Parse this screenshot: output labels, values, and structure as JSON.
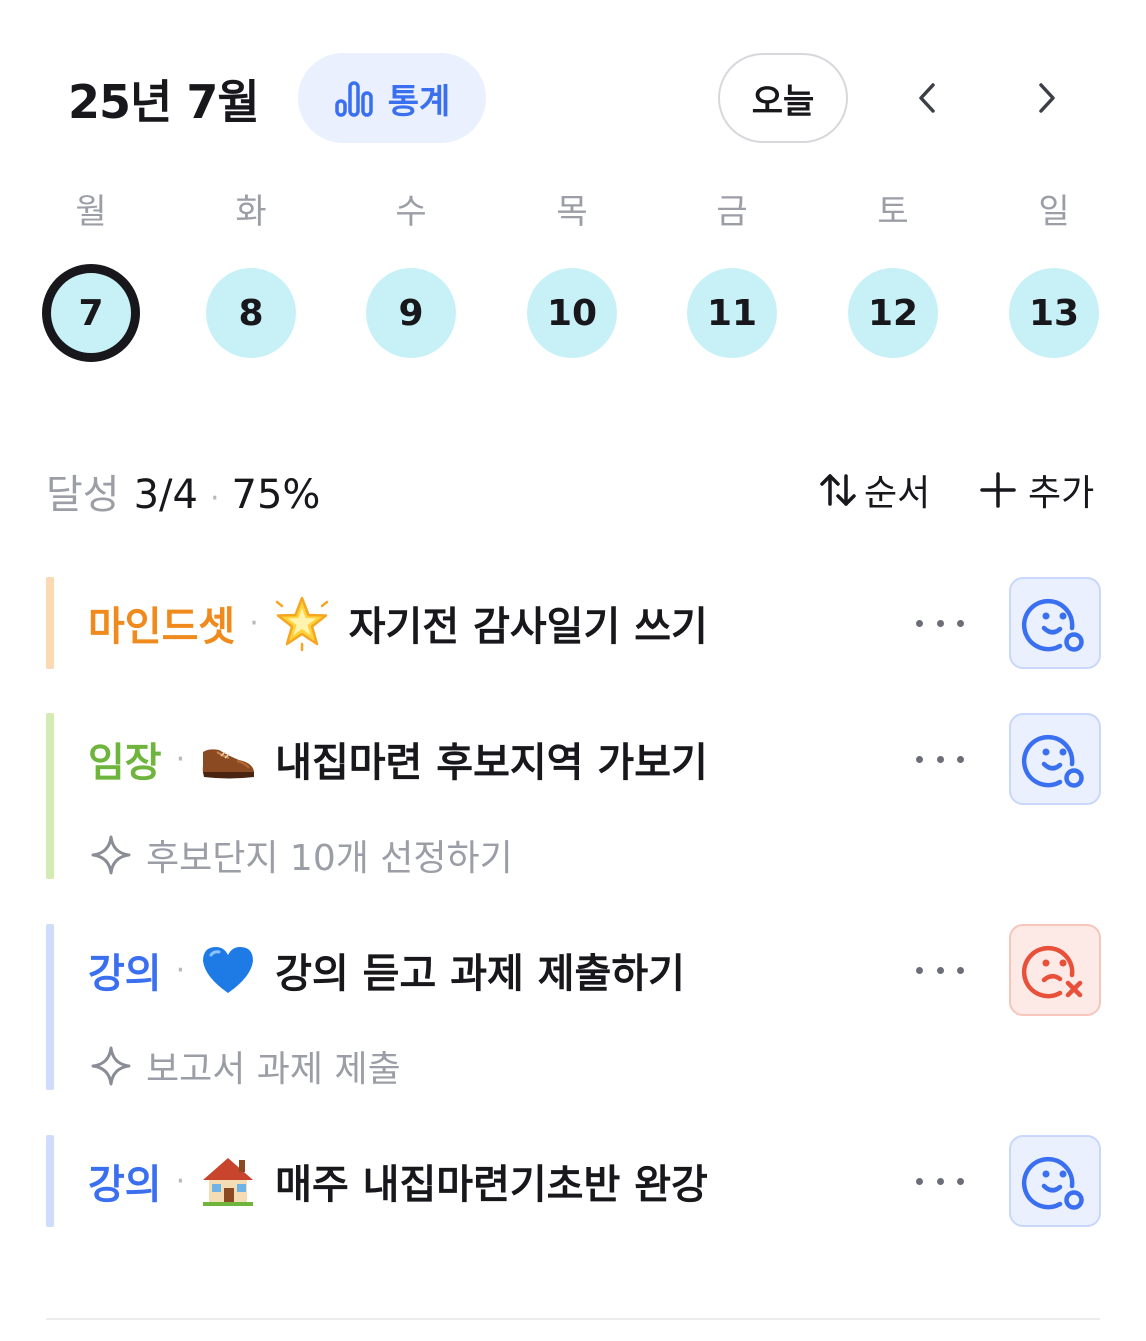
{
  "header": {
    "month_title": "25년 7월",
    "stats_label": "통계",
    "today_label": "오늘",
    "accent_color": "#3a6ff0"
  },
  "week": {
    "days": [
      {
        "label": "월",
        "date": "7",
        "selected": true
      },
      {
        "label": "화",
        "date": "8",
        "selected": false
      },
      {
        "label": "수",
        "date": "9",
        "selected": false
      },
      {
        "label": "목",
        "date": "10",
        "selected": false
      },
      {
        "label": "금",
        "date": "11",
        "selected": false
      },
      {
        "label": "토",
        "date": "12",
        "selected": false
      },
      {
        "label": "일",
        "date": "13",
        "selected": false
      }
    ],
    "circle_color": "#c7f1f6"
  },
  "summary": {
    "label": "달성",
    "count": "3/4",
    "separator": "·",
    "percent": "75%",
    "order_label": "순서",
    "add_label": "추가"
  },
  "tasks": [
    {
      "category": "마인드셋",
      "category_color": "#f08a1c",
      "bar_color": "#fbd9b3",
      "separator": "·",
      "emoji": "glowing-star-icon",
      "title": "자기전 감사일기 쓰기",
      "status": "pending"
    },
    {
      "category": "임장",
      "category_color": "#6fb43c",
      "bar_color": "#d3ecb3",
      "separator": "·",
      "emoji": "brown-shoe-icon",
      "title": "내집마련 후보지역 가보기",
      "subgoal": "후보단지 10개 선정하기",
      "status": "pending"
    },
    {
      "category": "강의",
      "category_color": "#3a6ff0",
      "bar_color": "#cfdcfb",
      "separator": "·",
      "emoji": "blue-heart-icon",
      "title": "강의 듣고 과제 제출하기",
      "subgoal": "보고서 과제 제출",
      "status": "fail"
    },
    {
      "category": "강의",
      "category_color": "#3a6ff0",
      "bar_color": "#cfdcfb",
      "separator": "·",
      "emoji": "house-icon",
      "title": "매주 내집마련기초반 완강",
      "status": "pending"
    }
  ]
}
